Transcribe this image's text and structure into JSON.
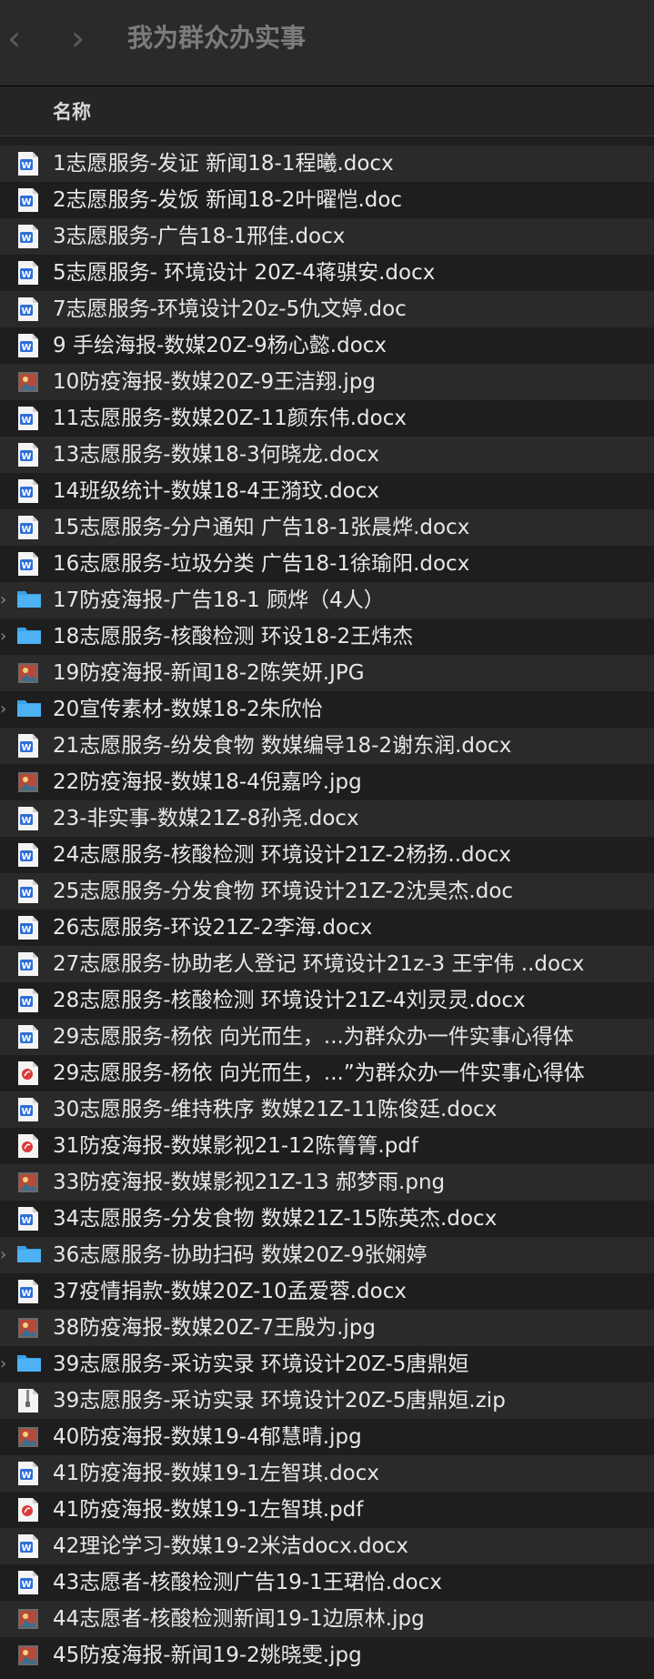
{
  "window": {
    "back_glyph": "‹",
    "forward_glyph": "›",
    "title": "我为群众办实事"
  },
  "header": {
    "name_column": "名称"
  },
  "files": [
    {
      "name": "1志愿服务-发证  新闻18-1程曦.docx",
      "icon": "word-doc-icon",
      "folder": false
    },
    {
      "name": "2志愿服务-发饭 新闻18-2叶曜恺.doc",
      "icon": "word-doc-icon",
      "folder": false
    },
    {
      "name": "3志愿服务-广告18-1邢佳.docx",
      "icon": "word-doc-icon",
      "folder": false
    },
    {
      "name": "5志愿服务- 环境设计 20Z-4蒋骐安.docx",
      "icon": "word-doc-icon",
      "folder": false
    },
    {
      "name": "7志愿服务-环境设计20z-5仇文婷.doc",
      "icon": "word-doc-icon",
      "folder": false
    },
    {
      "name": "9 手绘海报-数媒20Z-9杨心懿.docx",
      "icon": "word-doc-icon",
      "folder": false
    },
    {
      "name": "10防疫海报-数媒20Z-9王洁翔.jpg",
      "icon": "image-thumbnail-icon",
      "folder": false
    },
    {
      "name": "11志愿服务-数媒20Z-11颜东伟.docx",
      "icon": "word-doc-icon",
      "folder": false
    },
    {
      "name": "13志愿服务-数媒18-3何晓龙.docx",
      "icon": "word-doc-icon",
      "folder": false
    },
    {
      "name": "14班级统计-数媒18-4王漪玟.docx",
      "icon": "word-doc-icon",
      "folder": false
    },
    {
      "name": "15志愿服务-分户通知 广告18-1张晨烨.docx",
      "icon": "word-doc-icon",
      "folder": false
    },
    {
      "name": "16志愿服务-垃圾分类 广告18-1徐瑜阳.docx",
      "icon": "word-doc-icon",
      "folder": false
    },
    {
      "name": "17防疫海报-广告18-1 顾烨（4人）",
      "icon": "folder-icon",
      "folder": true
    },
    {
      "name": "18志愿服务-核酸检测 环设18-2王炜杰",
      "icon": "folder-icon",
      "folder": true
    },
    {
      "name": "19防疫海报-新闻18-2陈笑妍.JPG",
      "icon": "image-thumbnail-icon",
      "folder": false
    },
    {
      "name": "20宣传素材-数媒18-2朱欣怡",
      "icon": "folder-icon",
      "folder": true
    },
    {
      "name": "21志愿服务-纷发食物 数媒编导18-2谢东润.docx",
      "icon": "word-doc-icon",
      "folder": false
    },
    {
      "name": "22防疫海报-数媒18-4倪嘉吟.jpg",
      "icon": "image-thumbnail-icon",
      "folder": false
    },
    {
      "name": "23-非实事-数媒21Z-8孙尧.docx",
      "icon": "word-doc-icon",
      "folder": false
    },
    {
      "name": "24志愿服务-核酸检测 环境设计21Z-2杨扬..docx",
      "icon": "word-doc-icon",
      "folder": false
    },
    {
      "name": "25志愿服务-分发食物 环境设计21Z-2沈昊杰.doc",
      "icon": "word-doc-icon",
      "folder": false
    },
    {
      "name": "26志愿服务-环设21Z-2李海.docx",
      "icon": "word-doc-icon",
      "folder": false
    },
    {
      "name": "27志愿服务-协助老人登记 环境设计21z-3 王宇伟 ..docx",
      "icon": "word-doc-icon",
      "folder": false
    },
    {
      "name": "28志愿服务-核酸检测 环境设计21Z-4刘灵灵.docx",
      "icon": "word-doc-icon",
      "folder": false
    },
    {
      "name": "29志愿服务-杨依 向光而生，...为群众办一件实事心得体",
      "icon": "word-doc-icon",
      "folder": false
    },
    {
      "name": "29志愿服务-杨依 向光而生，...”为群众办一件实事心得体",
      "icon": "pdf-icon",
      "folder": false
    },
    {
      "name": "30志愿服务-维持秩序 数媒21Z-11陈俊廷.docx",
      "icon": "word-doc-icon",
      "folder": false
    },
    {
      "name": "31防疫海报-数媒影视21-12陈箐箐.pdf",
      "icon": "pdf-icon",
      "folder": false
    },
    {
      "name": "33防疫海报-数媒影视21Z-13 郝梦雨.png",
      "icon": "image-thumbnail-icon",
      "folder": false
    },
    {
      "name": "34志愿服务-分发食物 数媒21Z-15陈英杰.docx",
      "icon": "word-doc-icon",
      "folder": false
    },
    {
      "name": "36志愿服务-协助扫码 数媒20Z-9张娴婷",
      "icon": "folder-icon",
      "folder": true
    },
    {
      "name": "37疫情捐款-数媒20Z-10孟爱蓉.docx",
      "icon": "word-doc-icon",
      "folder": false
    },
    {
      "name": "38防疫海报-数媒20Z-7王殷为.jpg",
      "icon": "image-thumbnail-icon",
      "folder": false
    },
    {
      "name": "39志愿服务-采访实录 环境设计20Z-5唐鼎姮",
      "icon": "folder-icon",
      "folder": true
    },
    {
      "name": "39志愿服务-采访实录 环境设计20Z-5唐鼎姮.zip",
      "icon": "zip-archive-icon",
      "folder": false
    },
    {
      "name": "40防疫海报-数媒19-4郁慧晴.jpg",
      "icon": "image-thumbnail-icon",
      "folder": false
    },
    {
      "name": "41防疫海报-数媒19-1左智琪.docx",
      "icon": "word-doc-icon",
      "folder": false
    },
    {
      "name": "41防疫海报-数媒19-1左智琪.pdf",
      "icon": "pdf-icon",
      "folder": false
    },
    {
      "name": "42理论学习-数媒19-2米洁docx.docx",
      "icon": "word-doc-icon",
      "folder": false
    },
    {
      "name": "43志愿者-核酸检测广告19-1王珺怡.docx",
      "icon": "word-doc-icon",
      "folder": false
    },
    {
      "name": "44志愿者-核酸检测新闻19-1边原林.jpg",
      "icon": "image-thumbnail-icon",
      "folder": false
    },
    {
      "name": "45防疫海报-新闻19-2姚晓雯.jpg",
      "icon": "image-thumbnail-icon",
      "folder": false
    }
  ]
}
